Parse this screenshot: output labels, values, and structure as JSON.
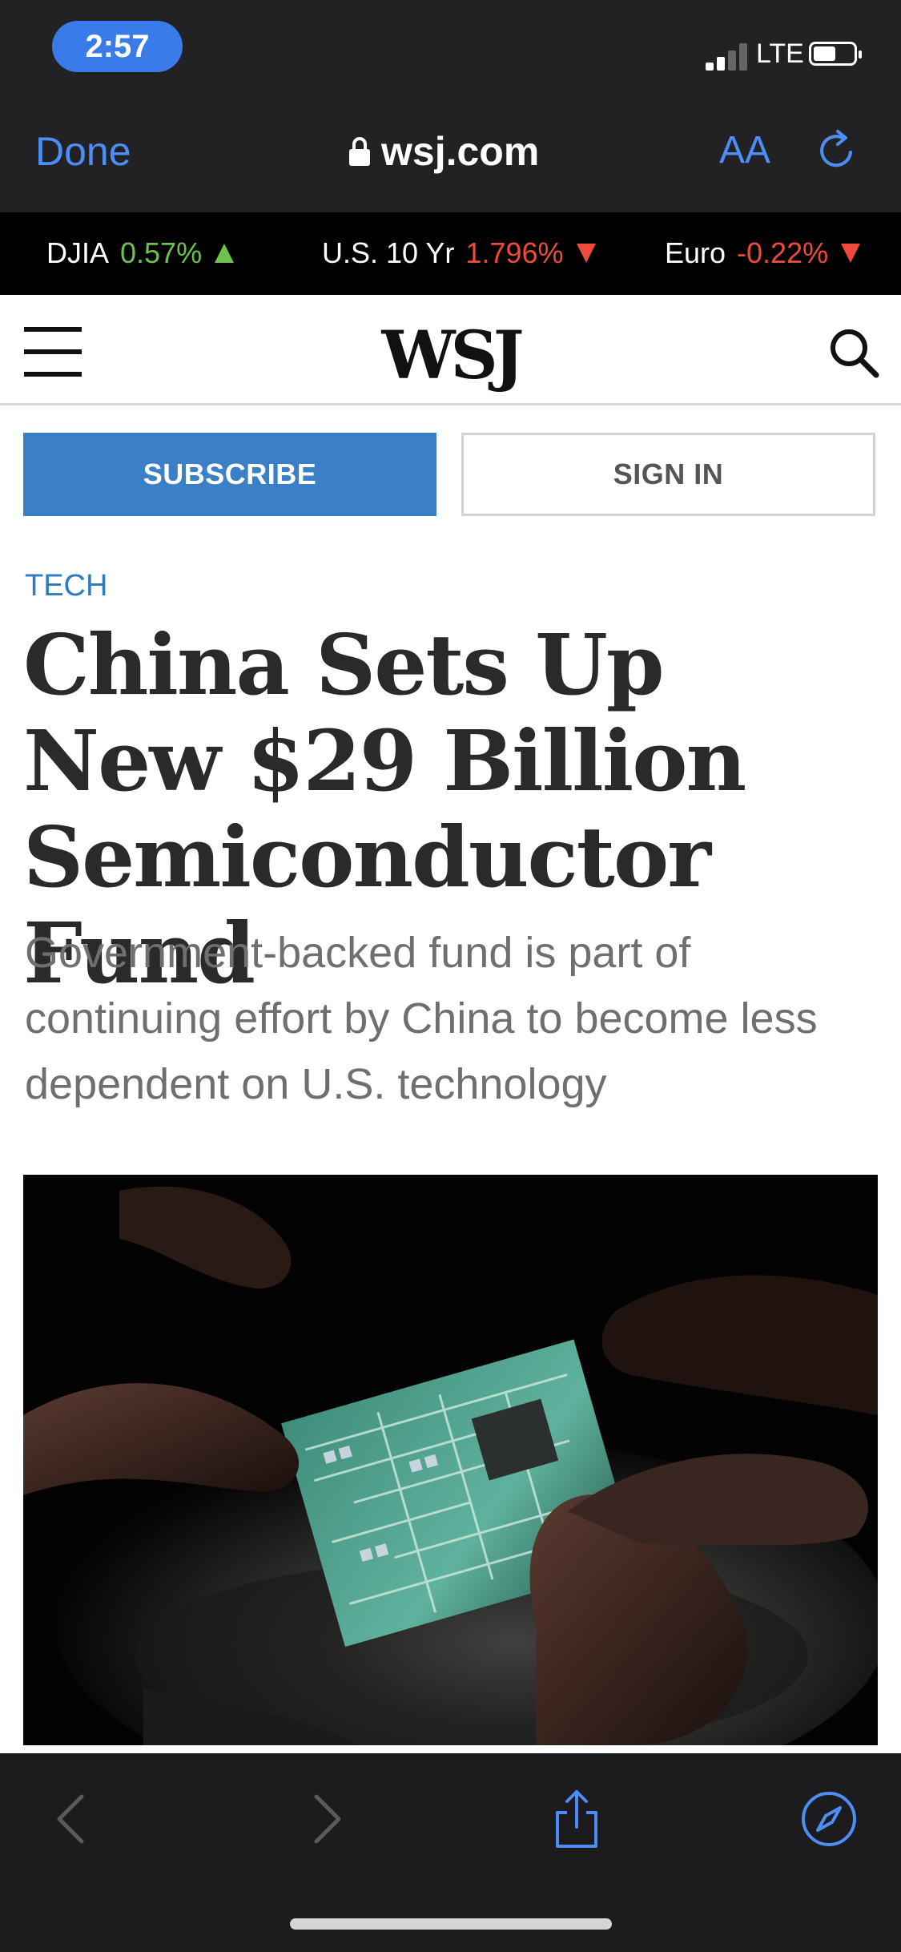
{
  "status_bar": {
    "time": "2:57",
    "network": "LTE"
  },
  "browser": {
    "done_label": "Done",
    "url": "wsj.com",
    "reader_label": "AA"
  },
  "ticker": [
    {
      "name": "DJIA",
      "value": "0.57%",
      "direction": "up"
    },
    {
      "name": "U.S. 10 Yr",
      "value": "1.796%",
      "direction": "down"
    },
    {
      "name": "Euro",
      "value": "-0.22%",
      "direction": "down"
    }
  ],
  "header": {
    "logo": "WSJ"
  },
  "actions": {
    "subscribe": "SUBSCRIBE",
    "sign_in": "SIGN IN"
  },
  "article": {
    "section": "TECH",
    "headline": "China Sets Up New $29 Billion Semiconductor Fund",
    "dek": "Government-backed fund is part of continuing effort by China to become less dependent on U.S. technology"
  },
  "colors": {
    "link_blue": "#4c8ef5",
    "subscribe_blue": "#3b80c6",
    "ticker_up": "#6cc24a",
    "ticker_down": "#f04a3a"
  }
}
